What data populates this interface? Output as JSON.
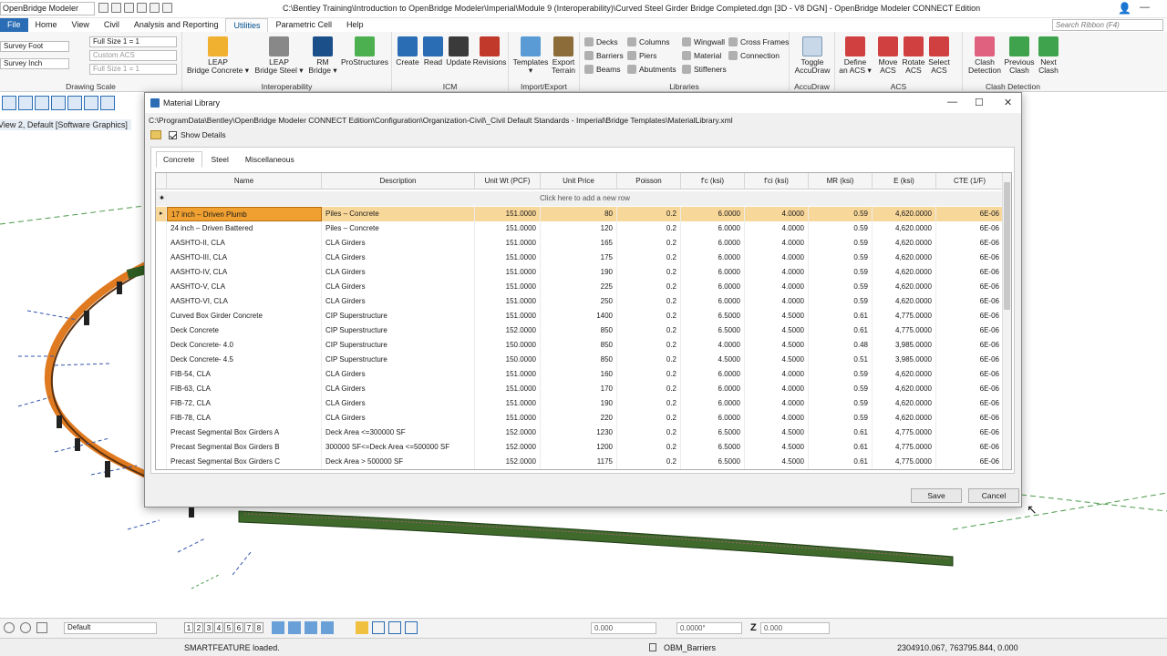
{
  "titlebar": {
    "workflow": "OpenBridge Modeler",
    "title": "C:\\Bentley Training\\Introduction to OpenBridge Modeler\\Imperial\\Module 9 (Interoperability)\\Curved Steel Girder Bridge Completed.dgn [3D - V8 DGN] - OpenBridge Modeler CONNECT Edition",
    "minimize": "—",
    "maximize": "☐",
    "close": "✕"
  },
  "menu": [
    "File",
    "Home",
    "View",
    "Civil",
    "Analysis and Reporting",
    "Utilities",
    "Parametric Cell",
    "Help"
  ],
  "menu_active": "Utilities",
  "search_ribbon": "Search Ribbon (F4)",
  "ribbon": {
    "drawing_scale": {
      "label": "Drawing Scale",
      "unit1": "Survey Foot",
      "unit2": "Survey Inch",
      "scale": "Full Size 1 = 1",
      "acs": "Custom ACS",
      "scale2": "Full Size 1 = 1"
    },
    "interoperability": {
      "label": "Interoperability",
      "b1": "LEAP\nBridge Concrete ▾",
      "b2": "LEAP\nBridge Steel ▾",
      "b3": "RM\nBridge ▾",
      "b4": "ProStructures"
    },
    "icm": {
      "label": "ICM",
      "b1": "Create",
      "b2": "Read",
      "b3": "Update",
      "b4": "Revisions"
    },
    "import_export": {
      "label": "Import/Export",
      "b1": "Templates\n▾",
      "b2": "Export\nTerrain"
    },
    "libraries": {
      "label": "Libraries",
      "items": [
        "Decks",
        "Columns",
        "Wingwall",
        "Cross Frames",
        "Barriers",
        "Piers",
        "Material",
        "Connection",
        "Beams",
        "Abutments",
        "Stiffeners"
      ]
    },
    "accudraw": {
      "label": "AccuDraw",
      "b1": "Toggle\nAccuDraw"
    },
    "acs": {
      "label": "ACS",
      "b1": "Define\nan ACS ▾",
      "b2": "Move\nACS",
      "b3": "Rotate\nACS",
      "b4": "Select\nACS"
    },
    "clash": {
      "label": "Clash Detection",
      "b1": "Clash\nDetection",
      "b2": "Previous\nClash",
      "b3": "Next\nClash"
    }
  },
  "viewport": {
    "title": "View 2, Default [Software Graphics]"
  },
  "dialog": {
    "title": "Material Library",
    "path": "C:\\ProgramData\\Bentley\\OpenBridge Modeler CONNECT Edition\\Configuration\\Organization-Civil\\_Civil Default Standards - Imperial\\Bridge Templates\\MaterialLibrary.xml",
    "show_details": "Show Details",
    "tabs": [
      "Concrete",
      "Steel",
      "Miscellaneous"
    ],
    "active_tab": "Concrete",
    "add_row": "Click here to add a new row",
    "columns": [
      "Name",
      "Description",
      "Unit Wt (PCF)",
      "Unit Price",
      "Poisson",
      "f'c (ksi)",
      "f'ci (ksi)",
      "MR (ksi)",
      "E (ksi)",
      "CTE (1/F)"
    ],
    "rows": [
      [
        "17 inch – Driven Plumb",
        "Piles – Concrete",
        "151.0000",
        "80",
        "0.2",
        "6.0000",
        "4.0000",
        "0.59",
        "4,620.0000",
        "6E-06"
      ],
      [
        "24 inch – Driven Battered",
        "Piles – Concrete",
        "151.0000",
        "120",
        "0.2",
        "6.0000",
        "4.0000",
        "0.59",
        "4,620.0000",
        "6E-06"
      ],
      [
        "AASHTO-II, CLA",
        "CLA Girders",
        "151.0000",
        "165",
        "0.2",
        "6.0000",
        "4.0000",
        "0.59",
        "4,620.0000",
        "6E-06"
      ],
      [
        "AASHTO-III, CLA",
        "CLA Girders",
        "151.0000",
        "175",
        "0.2",
        "6.0000",
        "4.0000",
        "0.59",
        "4,620.0000",
        "6E-06"
      ],
      [
        "AASHTO-IV, CLA",
        "CLA Girders",
        "151.0000",
        "190",
        "0.2",
        "6.0000",
        "4.0000",
        "0.59",
        "4,620.0000",
        "6E-06"
      ],
      [
        "AASHTO-V, CLA",
        "CLA Girders",
        "151.0000",
        "225",
        "0.2",
        "6.0000",
        "4.0000",
        "0.59",
        "4,620.0000",
        "6E-06"
      ],
      [
        "AASHTO-VI, CLA",
        "CLA Girders",
        "151.0000",
        "250",
        "0.2",
        "6.0000",
        "4.0000",
        "0.59",
        "4,620.0000",
        "6E-06"
      ],
      [
        "Curved Box Girder Concrete",
        "CIP Superstructure",
        "151.0000",
        "1400",
        "0.2",
        "6.5000",
        "4.5000",
        "0.61",
        "4,775.0000",
        "6E-06"
      ],
      [
        "Deck Concrete",
        "CIP Superstructure",
        "152.0000",
        "850",
        "0.2",
        "6.5000",
        "4.5000",
        "0.61",
        "4,775.0000",
        "6E-06"
      ],
      [
        "Deck Concrete- 4.0",
        "CIP Superstructure",
        "150.0000",
        "850",
        "0.2",
        "4.0000",
        "4.5000",
        "0.48",
        "3,985.0000",
        "6E-06"
      ],
      [
        "Deck Concrete- 4.5",
        "CIP Superstructure",
        "150.0000",
        "850",
        "0.2",
        "4.5000",
        "4.5000",
        "0.51",
        "3,985.0000",
        "6E-06"
      ],
      [
        "FIB-54, CLA",
        "CLA Girders",
        "151.0000",
        "160",
        "0.2",
        "6.0000",
        "4.0000",
        "0.59",
        "4,620.0000",
        "6E-06"
      ],
      [
        "FIB-63, CLA",
        "CLA Girders",
        "151.0000",
        "170",
        "0.2",
        "6.0000",
        "4.0000",
        "0.59",
        "4,620.0000",
        "6E-06"
      ],
      [
        "FIB-72, CLA",
        "CLA Girders",
        "151.0000",
        "190",
        "0.2",
        "6.0000",
        "4.0000",
        "0.59",
        "4,620.0000",
        "6E-06"
      ],
      [
        "FIB-78, CLA",
        "CLA Girders",
        "151.0000",
        "220",
        "0.2",
        "6.0000",
        "4.0000",
        "0.59",
        "4,620.0000",
        "6E-06"
      ],
      [
        "Precast Segmental Box Girders A",
        "Deck Area <=300000 SF",
        "152.0000",
        "1230",
        "0.2",
        "6.5000",
        "4.5000",
        "0.61",
        "4,775.0000",
        "6E-06"
      ],
      [
        "Precast Segmental Box Girders B",
        "300000 SF<=Deck Area <=500000 SF",
        "152.0000",
        "1200",
        "0.2",
        "6.5000",
        "4.5000",
        "0.61",
        "4,775.0000",
        "6E-06"
      ],
      [
        "Precast Segmental Box Girders C",
        "Deck Area > 500000 SF",
        "152.0000",
        "1175",
        "0.2",
        "6.5000",
        "4.5000",
        "0.61",
        "4,775.0000",
        "6E-06"
      ]
    ],
    "save": "Save",
    "cancel": "Cancel"
  },
  "viewtools": {
    "view_numbers": [
      "1",
      "2",
      "3",
      "4",
      "5",
      "6",
      "7",
      "8"
    ],
    "level": "Default",
    "x": "0.000",
    "angle": "0.0000°",
    "z_label": "Z",
    "z": "0.000"
  },
  "status": {
    "message": "SMARTFEATURE loaded.",
    "level": "OBM_Barriers",
    "coords": "2304910.067, 763795.844, 0.000"
  },
  "colors": {
    "accent": "#004e8c",
    "selected_row": "#f8d79a",
    "selected_cell": "#f0a030",
    "bridge_orange": "#e07a20",
    "deck_green": "#3f6a2c"
  }
}
